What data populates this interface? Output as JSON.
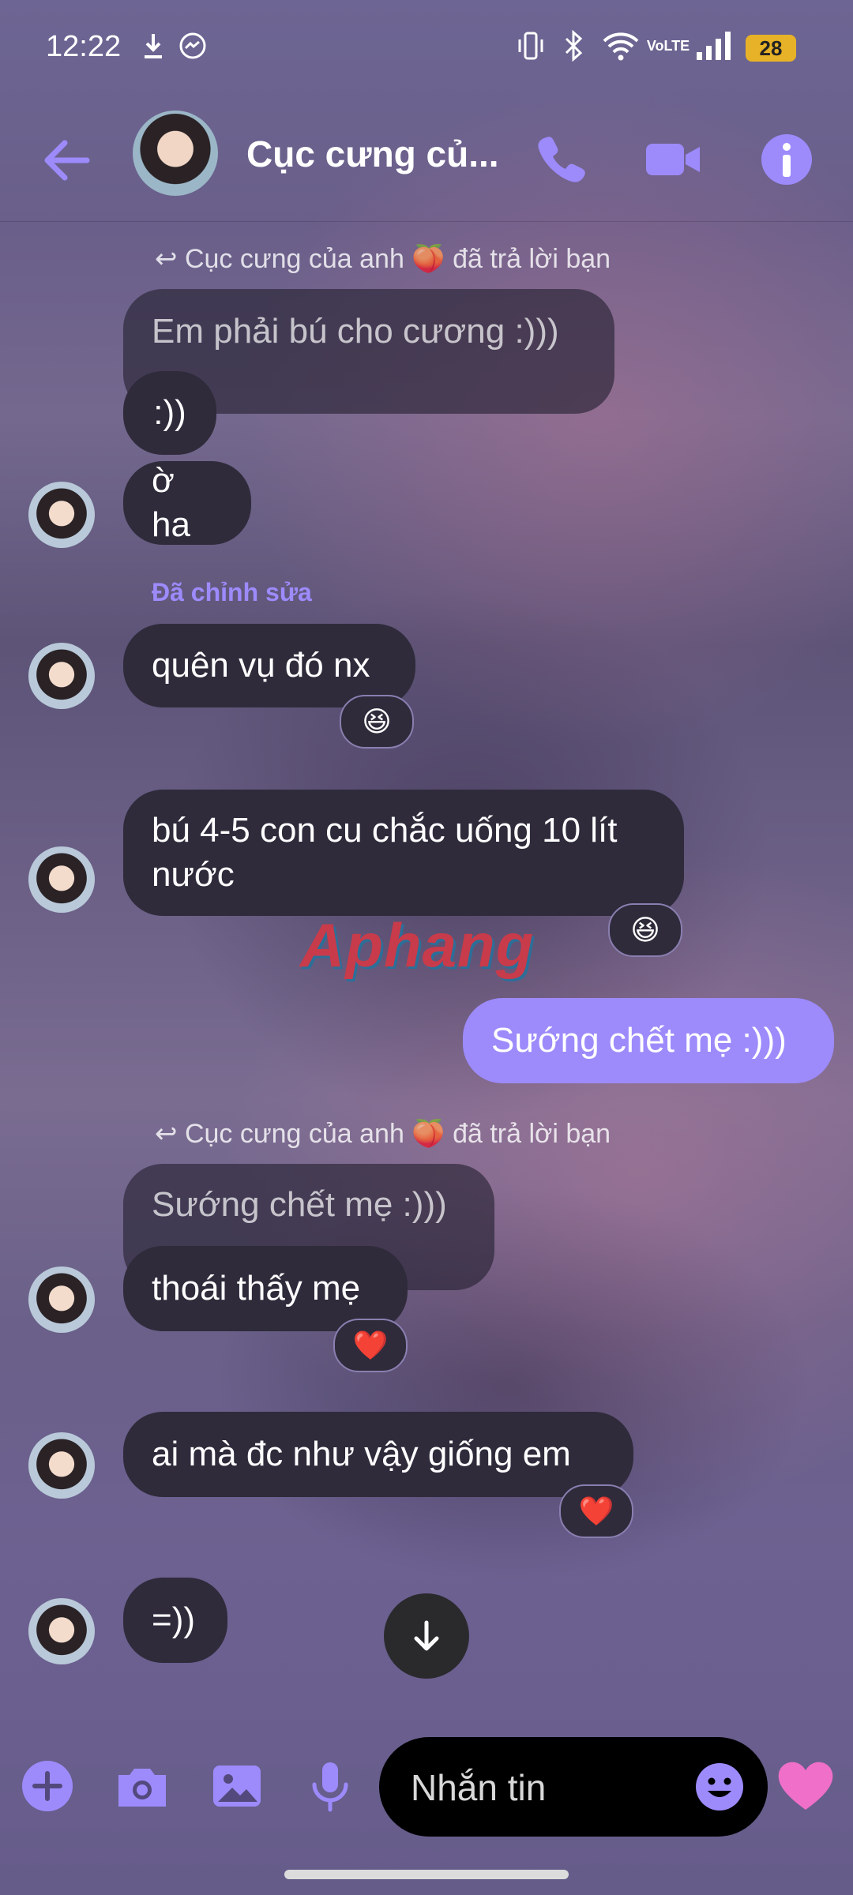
{
  "status_bar": {
    "time": "12:22",
    "network": "VoLTE",
    "battery": "28"
  },
  "header": {
    "title": "Cục cưng củ..."
  },
  "messages": {
    "reply_note_1": "Cục cưng của anh 🍑 đã trả lời bạn",
    "quoted_1": "Em phải bú cho cương :)))",
    "m1": ":))",
    "m2": "ờ ha",
    "edited_label": "Đã chỉnh sửa",
    "m3": "quên vụ đó nx",
    "m3_reaction": "😆",
    "m4_line1": "bú 4-5 con cu chắc uống 10 lít",
    "m4_line2": "nước",
    "m4_reaction": "😆",
    "mine_1": "Sướng chết mẹ :)))",
    "reply_note_2": "Cục cưng của anh 🍑 đã trả lời bạn",
    "quoted_2": "Sướng chết mẹ :)))",
    "m5": "thoái thấy mẹ",
    "m5_reaction": "❤️",
    "m6": "ai mà đc như vậy giống em",
    "m6_reaction": "❤️",
    "m7": "=))"
  },
  "watermark": "Aphang",
  "composer": {
    "placeholder": "Nhắn tin"
  },
  "colors": {
    "accent": "#9d8bfc",
    "bubble_other": "#2f2b3b",
    "bubble_mine": "#9d8bfc"
  },
  "icons": [
    "back-arrow-icon",
    "phone-icon",
    "video-camera-icon",
    "info-icon",
    "plus-icon",
    "camera-icon",
    "image-icon",
    "microphone-icon",
    "emoji-icon",
    "heart-icon",
    "arrow-down-icon"
  ]
}
